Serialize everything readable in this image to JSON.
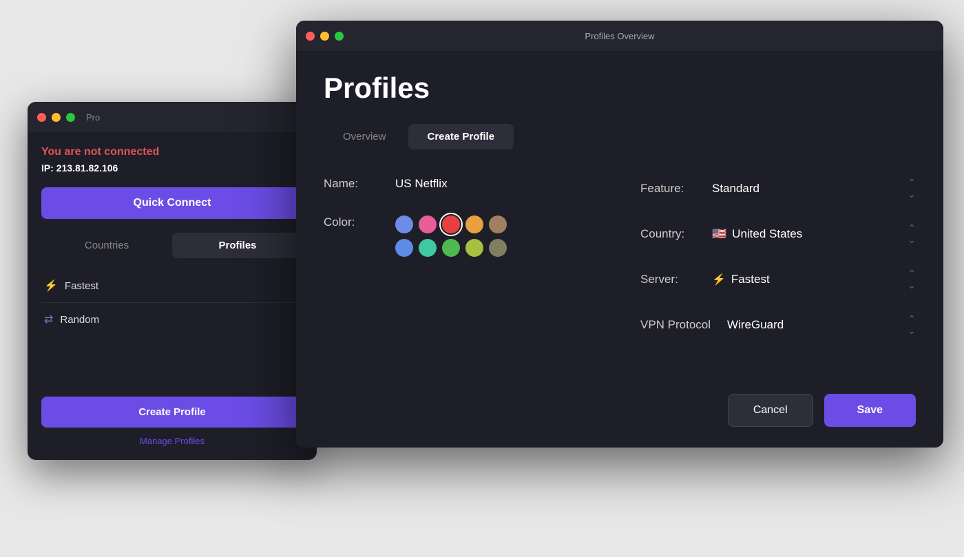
{
  "bg_window": {
    "title": "Pro",
    "connection_status": "You are not connected",
    "ip_label": "IP:",
    "ip_value": "213.81.82.106",
    "quick_connect": "Quick Connect",
    "tabs": [
      {
        "label": "Countries",
        "active": false
      },
      {
        "label": "Profiles",
        "active": true
      }
    ],
    "profile_items": [
      {
        "icon": "⚡",
        "label": "Fastest"
      },
      {
        "icon": "⇄",
        "label": "Random"
      }
    ],
    "create_profile": "Create Profile",
    "manage_profiles": "Manage Profiles"
  },
  "fg_window": {
    "title": "Profiles Overview",
    "heading": "Profiles",
    "tabs": [
      {
        "label": "Overview",
        "active": false
      },
      {
        "label": "Create Profile",
        "active": true
      }
    ],
    "form": {
      "name_label": "Name:",
      "name_value": "US Netflix",
      "color_label": "Color:",
      "colors": [
        {
          "hex": "#6c8ce8",
          "selected": false
        },
        {
          "hex": "#e85c9a",
          "selected": false
        },
        {
          "hex": "#e84040",
          "selected": true
        },
        {
          "hex": "#e8a040",
          "selected": false
        },
        {
          "hex": "#a08060",
          "selected": false
        },
        {
          "hex": "#5c8ce8",
          "selected": false
        },
        {
          "hex": "#40c8a0",
          "selected": false
        },
        {
          "hex": "#50b850",
          "selected": false
        },
        {
          "hex": "#a8c040",
          "selected": false
        },
        {
          "hex": "#808060",
          "selected": false
        }
      ],
      "feature_label": "Feature:",
      "feature_value": "Standard",
      "country_label": "Country:",
      "country_flag": "🇺🇸",
      "country_value": "United States",
      "server_label": "Server:",
      "server_icon": "⚡",
      "server_value": "Fastest",
      "vpn_protocol_label": "VPN Protocol",
      "vpn_protocol_value": "WireGuard"
    },
    "cancel_label": "Cancel",
    "save_label": "Save"
  }
}
